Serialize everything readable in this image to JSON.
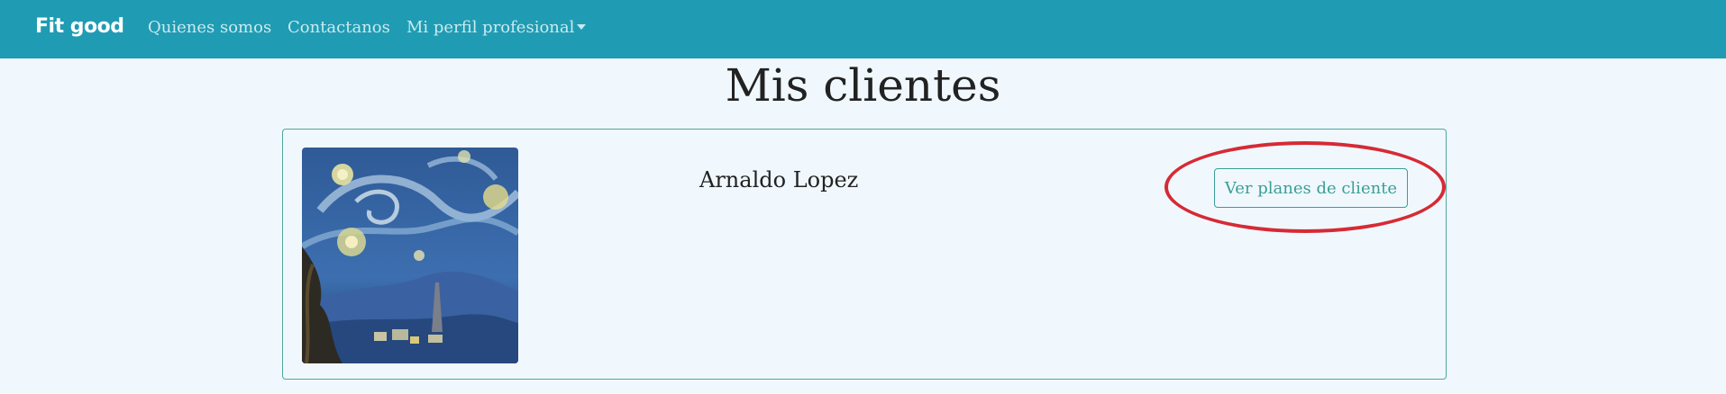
{
  "navbar": {
    "brand": "Fit good",
    "links": [
      {
        "label": "Quienes somos"
      },
      {
        "label": "Contactanos"
      },
      {
        "label": "Mi perfil profesional"
      }
    ]
  },
  "main": {
    "title": "Mis clientes",
    "clients": [
      {
        "name": "Arnaldo Lopez",
        "button_label": "Ver planes de cliente"
      }
    ]
  },
  "colors": {
    "navbar_bg": "#1f9cb3",
    "page_bg": "#f0f8fe",
    "accent": "#3a9e95",
    "highlight": "#d62a35"
  }
}
